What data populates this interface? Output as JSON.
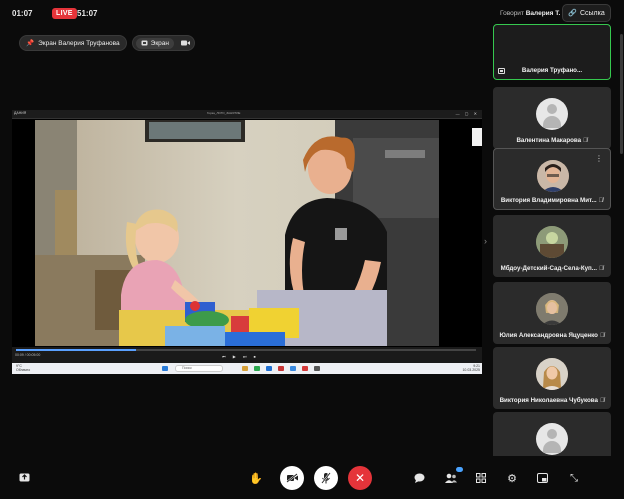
{
  "header": {
    "clock": "01:07",
    "live_label": "LIVE",
    "recording_time": "51:07",
    "speaker_prefix": "Говорит",
    "speaker_name": "Валерия Т.",
    "link_label": "Ссылка"
  },
  "chips": {
    "pinned_label": "Экран Валерия Труфанова",
    "screen_label": "Экран"
  },
  "shared_screen": {
    "window_title": "Горка_ЛОГО_ЗАНЯТИЕ",
    "window_left_label": "ДАНИЯ",
    "current_time": "00:09 / 00:05:00",
    "taskbar_weather": "9°С\nОблачно",
    "taskbar_search": "Поиск",
    "taskbar_tray": "9:21\n10.03.2025"
  },
  "participants": [
    {
      "name": "Валерия Труфано...",
      "active": true,
      "sharing": true
    },
    {
      "name": "Валентина Макарова",
      "muted": true
    },
    {
      "name": "Виктория Владимировна Мит...",
      "muted": true
    },
    {
      "name": "Мбдоу-Детский-Сад-Села-Куп...",
      "muted": true
    },
    {
      "name": "Юлия Александровна Яцуценко",
      "muted": true
    },
    {
      "name": "Виктория Николаевна Чубукова",
      "muted": true
    },
    {
      "name": ""
    }
  ],
  "icons": {
    "mic_off": "mic-off-icon",
    "camera_off": "camera-off-icon"
  },
  "colors": {
    "live_red": "#e5343a",
    "end_call_red": "#e5343a",
    "active_speaker_green": "#36c84f",
    "background": "#0b0b0b"
  }
}
